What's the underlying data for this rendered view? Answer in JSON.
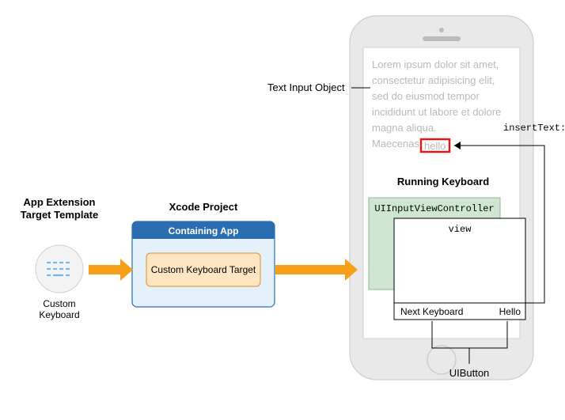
{
  "left": {
    "heading_l1": "App Extension",
    "heading_l2": "Target Template",
    "icon_label": "Custom\nKeyboard"
  },
  "mid": {
    "heading": "Xcode Project",
    "container_title": "Containing App",
    "target_label": "Custom Keyboard Target"
  },
  "right": {
    "heading": "Running Keyboard",
    "lorem": "Lorem ipsum dolor sit amet, consectetur adipisicing elit, sed do eiusmod tempor incididunt ut labore et dolore magna aliqua.",
    "maecenas": "Maecenas",
    "hello": "hello",
    "view_controller": "UIInputViewController",
    "view_label": "view",
    "next_keyboard": "Next Keyboard",
    "hello_btn": "Hello"
  },
  "callouts": {
    "text_input": "Text Input Object",
    "insert_text": "insertText:",
    "uibutton": "UIButton"
  }
}
